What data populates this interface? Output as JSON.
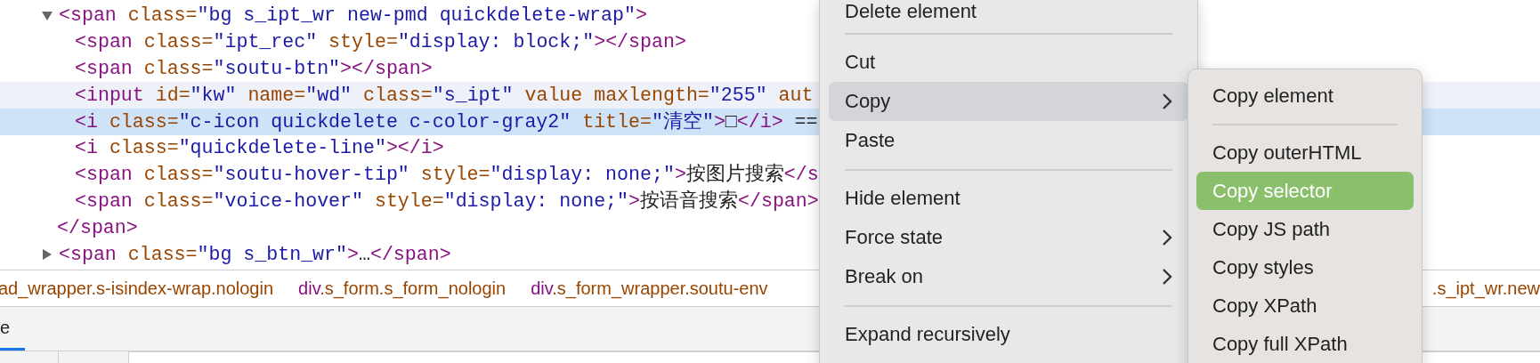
{
  "dom_tree": [
    {
      "tokens": [
        {
          "kind": "tag",
          "text": "<span"
        },
        {
          "kind": "attr",
          "text": " class="
        },
        {
          "kind": "value",
          "text": "\"bg s_ipt_wr new-pmd quickdelete-wrap\""
        },
        {
          "kind": "tag",
          "text": ">"
        }
      ],
      "expanded": true,
      "selected": false,
      "hovered": false,
      "children": [
        {
          "tokens": [
            {
              "kind": "tag",
              "text": "<span"
            },
            {
              "kind": "attr",
              "text": " class="
            },
            {
              "kind": "value",
              "text": "\"ipt_rec\""
            },
            {
              "kind": "attr",
              "text": " style="
            },
            {
              "kind": "value",
              "text": "\"display: block;\""
            },
            {
              "kind": "tag",
              "text": "></span>"
            }
          ],
          "selected": false,
          "hovered": false
        },
        {
          "tokens": [
            {
              "kind": "tag",
              "text": "<span"
            },
            {
              "kind": "attr",
              "text": " class="
            },
            {
              "kind": "value",
              "text": "\"soutu-btn\""
            },
            {
              "kind": "tag",
              "text": "></span>"
            }
          ],
          "selected": false,
          "hovered": false
        },
        {
          "tokens": [
            {
              "kind": "tag",
              "text": "<input"
            },
            {
              "kind": "attr",
              "text": " id="
            },
            {
              "kind": "value",
              "text": "\"kw\""
            },
            {
              "kind": "attr",
              "text": " name="
            },
            {
              "kind": "value",
              "text": "\"wd\""
            },
            {
              "kind": "attr",
              "text": " class="
            },
            {
              "kind": "value",
              "text": "\"s_ipt\""
            },
            {
              "kind": "attr",
              "text": " value maxlength="
            },
            {
              "kind": "value",
              "text": "\"255\""
            },
            {
              "kind": "attr",
              "text": " aut"
            }
          ],
          "selected": false,
          "hovered": true
        },
        {
          "tokens": [
            {
              "kind": "tag",
              "text": "<i"
            },
            {
              "kind": "attr",
              "text": " class="
            },
            {
              "kind": "value",
              "text": "\"c-icon quickdelete c-color-gray2\""
            },
            {
              "kind": "attr",
              "text": " title="
            },
            {
              "kind": "value",
              "text": "\"清空\""
            },
            {
              "kind": "tag",
              "text": ">"
            },
            {
              "kind": "text",
              "text": "□"
            },
            {
              "kind": "tag",
              "text": "</i>"
            },
            {
              "kind": "text",
              "text": " =="
            }
          ],
          "selected": true,
          "hovered": false
        },
        {
          "tokens": [
            {
              "kind": "tag",
              "text": "<i"
            },
            {
              "kind": "attr",
              "text": " class="
            },
            {
              "kind": "value",
              "text": "\"quickdelete-line\""
            },
            {
              "kind": "tag",
              "text": "></i>"
            }
          ],
          "selected": false,
          "hovered": false
        },
        {
          "tokens": [
            {
              "kind": "tag",
              "text": "<span"
            },
            {
              "kind": "attr",
              "text": " class="
            },
            {
              "kind": "value",
              "text": "\"soutu-hover-tip\""
            },
            {
              "kind": "attr",
              "text": " style="
            },
            {
              "kind": "value",
              "text": "\"display: none;\""
            },
            {
              "kind": "tag",
              "text": ">"
            },
            {
              "kind": "text",
              "text": "按图片搜索"
            },
            {
              "kind": "tag",
              "text": "</s"
            }
          ],
          "selected": false,
          "hovered": false
        },
        {
          "tokens": [
            {
              "kind": "tag",
              "text": "<span"
            },
            {
              "kind": "attr",
              "text": " class="
            },
            {
              "kind": "value",
              "text": "\"voice-hover\""
            },
            {
              "kind": "attr",
              "text": " style="
            },
            {
              "kind": "value",
              "text": "\"display: none;\""
            },
            {
              "kind": "tag",
              "text": ">"
            },
            {
              "kind": "text",
              "text": "按语音搜索"
            },
            {
              "kind": "tag",
              "text": "</span>"
            }
          ],
          "selected": false,
          "hovered": false
        }
      ],
      "closing": [
        {
          "kind": "tag",
          "text": "</span>"
        }
      ]
    },
    {
      "tokens": [
        {
          "kind": "tag",
          "text": "<span"
        },
        {
          "kind": "attr",
          "text": " class="
        },
        {
          "kind": "value",
          "text": "\"bg s_btn_wr\""
        },
        {
          "kind": "tag",
          "text": ">"
        },
        {
          "kind": "text",
          "text": "…"
        },
        {
          "kind": "tag",
          "text": "</span>"
        }
      ],
      "expanded": false,
      "selected": false,
      "hovered": false
    }
  ],
  "breadcrumbs": [
    {
      "classes": "ad_wrapper.s-isindex-wrap.nologin"
    },
    {
      "tag": "div",
      "classes": ".s_form.s_form_nologin"
    },
    {
      "tag": "div",
      "classes": ".s_form_wrapper.soutu-env"
    },
    {
      "classes": ".s_ipt_wr.new"
    }
  ],
  "tabs": [
    {
      "label": "e",
      "selected": true
    }
  ],
  "context_menu": [
    {
      "kind": "item",
      "label": "Delete element",
      "selected": false
    },
    {
      "kind": "separator"
    },
    {
      "kind": "item",
      "label": "Cut",
      "selected": false
    },
    {
      "kind": "item",
      "label": "Copy",
      "selected": true,
      "submenu": true
    },
    {
      "kind": "item",
      "label": "Paste",
      "selected": false
    },
    {
      "kind": "separator"
    },
    {
      "kind": "item",
      "label": "Hide element",
      "selected": false
    },
    {
      "kind": "item",
      "label": "Force state",
      "selected": false,
      "submenu": true
    },
    {
      "kind": "item",
      "label": "Break on",
      "selected": false,
      "submenu": true
    },
    {
      "kind": "separator"
    },
    {
      "kind": "item",
      "label": "Expand recursively",
      "selected": false
    }
  ],
  "copy_submenu": [
    {
      "kind": "item",
      "label": "Copy element",
      "selected": false
    },
    {
      "kind": "separator"
    },
    {
      "kind": "item",
      "label": "Copy outerHTML",
      "selected": false
    },
    {
      "kind": "item",
      "label": "Copy selector",
      "selected": true
    },
    {
      "kind": "item",
      "label": "Copy JS path",
      "selected": false
    },
    {
      "kind": "item",
      "label": "Copy styles",
      "selected": false
    },
    {
      "kind": "item",
      "label": "Copy XPath",
      "selected": false
    },
    {
      "kind": "item",
      "label": "Copy full XPath",
      "selected": false
    }
  ]
}
